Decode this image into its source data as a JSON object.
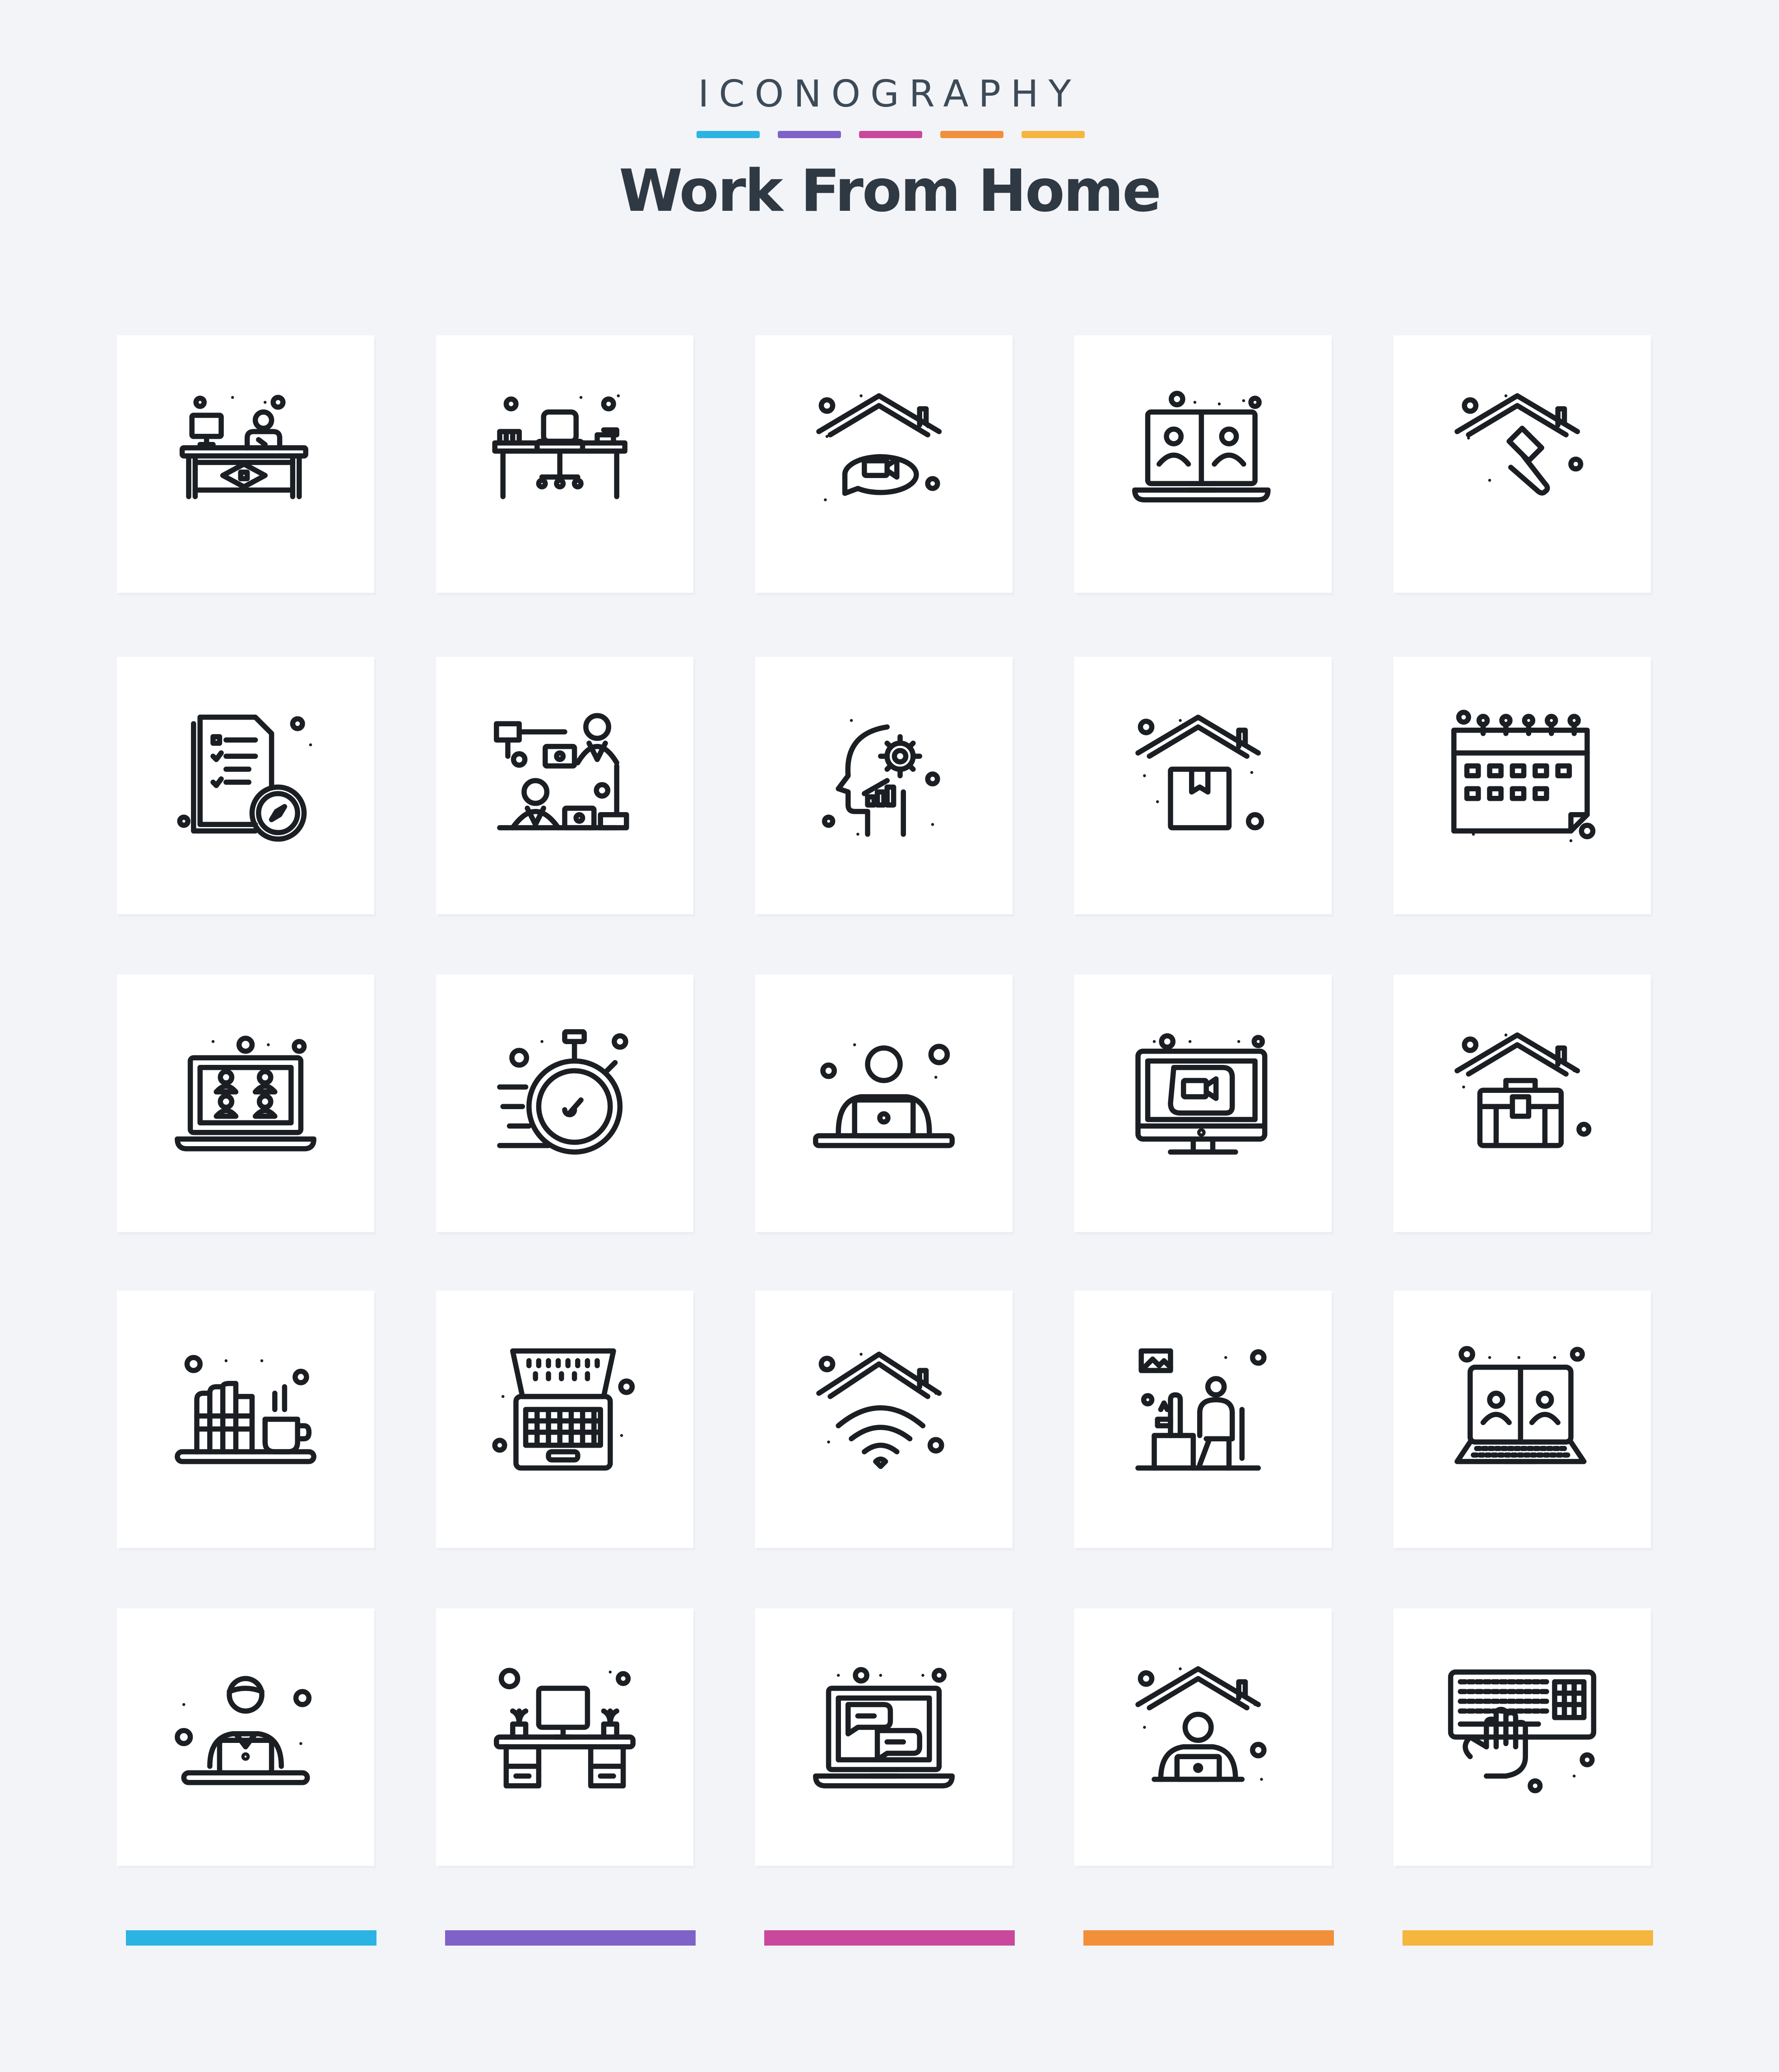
{
  "header": {
    "brand": "ICONOGRAPHY",
    "title": "Work From Home",
    "accent_colors": [
      "#2bb3e3",
      "#7e62c7",
      "#c9489b",
      "#f28f3b",
      "#f4b63d"
    ]
  },
  "icons": [
    [
      "desk-worker-icon",
      "office-chair-desk-icon",
      "home-video-call-icon",
      "laptop-video-meeting-icon",
      "home-repair-hammer-icon"
    ],
    [
      "task-checklist-timer-icon",
      "remote-team-connection-icon",
      "mind-settings-growth-icon",
      "home-delivery-box-icon",
      "calendar-icon"
    ],
    [
      "laptop-group-call-icon",
      "stopwatch-icon",
      "person-on-laptop-icon",
      "monitor-video-call-icon",
      "home-briefcase-icon"
    ],
    [
      "books-and-coffee-icon",
      "typewriter-laptop-icon",
      "home-wifi-icon",
      "person-at-computer-icon",
      "laptop-two-person-call-icon"
    ],
    [
      "woman-on-laptop-icon",
      "desk-monitor-plants-icon",
      "laptop-chat-icon",
      "home-person-laptop-icon",
      "keyboard-typing-hand-icon"
    ]
  ],
  "footer": {
    "bar_colors": [
      "#2bb3e3",
      "#7e62c7",
      "#c9489b",
      "#f28f3b",
      "#f4b63d"
    ]
  }
}
